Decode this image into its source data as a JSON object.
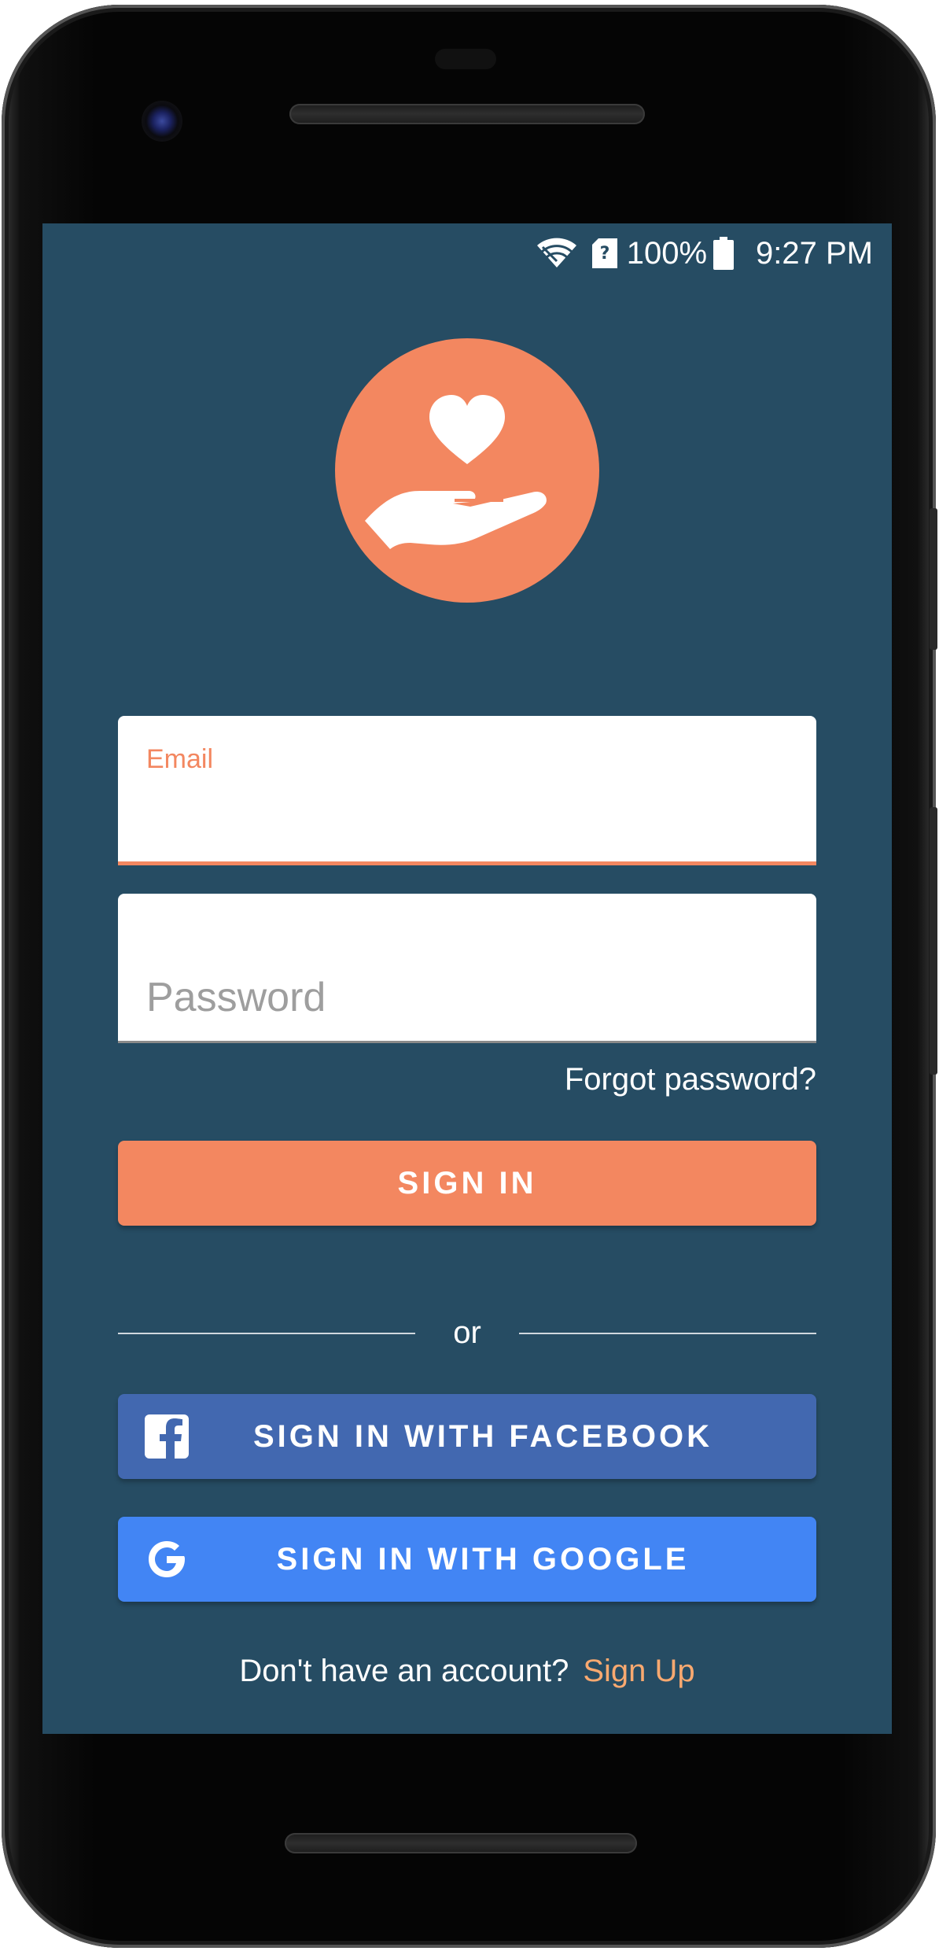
{
  "status_bar": {
    "battery_percent": "100%",
    "time": "9:27 PM",
    "icons": [
      "wifi-icon",
      "sim-unknown-icon",
      "battery-icon"
    ]
  },
  "logo": {
    "icon": "heart-in-hand-icon",
    "background_color": "#f38760"
  },
  "form": {
    "email": {
      "label": "Email",
      "value": "",
      "placeholder": ""
    },
    "password": {
      "label": "",
      "value": "",
      "placeholder": "Password"
    },
    "forgot_password_label": "Forgot password?"
  },
  "buttons": {
    "sign_in": "SIGN IN",
    "facebook": "SIGN IN WITH FACEBOOK",
    "google": "SIGN IN WITH GOOGLE"
  },
  "divider_text": "or",
  "footer": {
    "prompt": "Don't have an account?",
    "signup_link": "Sign Up"
  },
  "colors": {
    "background": "#264c63",
    "accent": "#f38760",
    "facebook": "#4268b0",
    "google": "#4285f4",
    "link": "#f9a970"
  }
}
